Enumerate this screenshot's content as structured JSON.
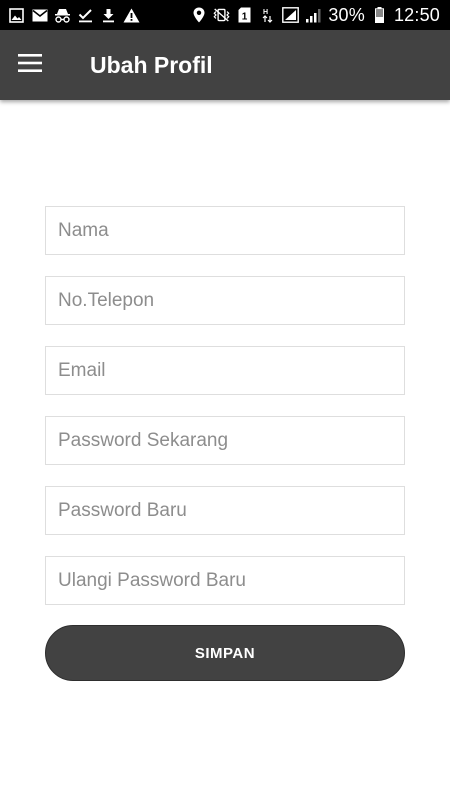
{
  "status_bar": {
    "left_icons": [
      "gallery-icon",
      "email-icon",
      "incognito-icon",
      "check-icon",
      "download-icon",
      "warning-icon"
    ],
    "right_icons": [
      "location-icon",
      "vibrate-icon",
      "sim-1-icon",
      "data-icon",
      "signal-icon",
      "signal-weak-icon"
    ],
    "battery": "30%",
    "battery_icon": "battery-icon",
    "time": "12:50"
  },
  "app_bar": {
    "menu_icon": "hamburger-menu-icon",
    "title": "Ubah Profil",
    "background": "#424242"
  },
  "form": {
    "name_placeholder": "Nama",
    "phone_placeholder": "No.Telepon",
    "email_placeholder": "Email",
    "current_password_placeholder": "Password Sekarang",
    "new_password_placeholder": "Password Baru",
    "repeat_password_placeholder": "Ulangi Password Baru",
    "submit_label": "SIMPAN"
  },
  "colors": {
    "accent": "#424242",
    "field_border": "#dedede",
    "placeholder": "#8d8d8d"
  }
}
